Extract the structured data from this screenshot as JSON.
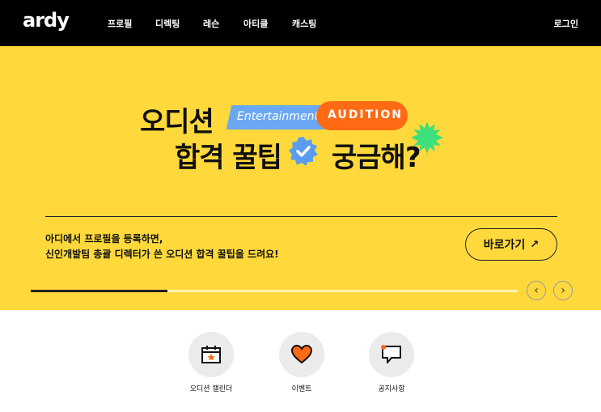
{
  "header": {
    "logo": "ardy",
    "nav": [
      "프로필",
      "디렉팅",
      "레슨",
      "아티클",
      "캐스팅"
    ],
    "login": "로그인"
  },
  "banner": {
    "headline_line1": "오디션",
    "headline_line2a": "합격 꿀팁",
    "headline_line2b": "궁금해?",
    "tag_entertainment": "Entertainment",
    "tag_audition": "AUDITION",
    "desc_line1": "아디에서 프로필을 등록하면,",
    "desc_line2": "신인개발팀 총괄 디렉터가 쓴 오디션 합격 꿀팁을 드려요!",
    "goto_label": "바로가기",
    "progress": 0.28,
    "colors": {
      "background": "#ffd93b",
      "entertainment_tag": "#6aa8f3",
      "audition_tag": "#ff6a13",
      "badge": "#5a9df0",
      "burst": "#3de07a"
    }
  },
  "quick_menu": [
    {
      "label": "오디션 캘린더",
      "icon": "calendar-icon"
    },
    {
      "label": "이벤트",
      "icon": "heart-icon"
    },
    {
      "label": "공지사항",
      "icon": "notice-bubble-icon"
    }
  ]
}
